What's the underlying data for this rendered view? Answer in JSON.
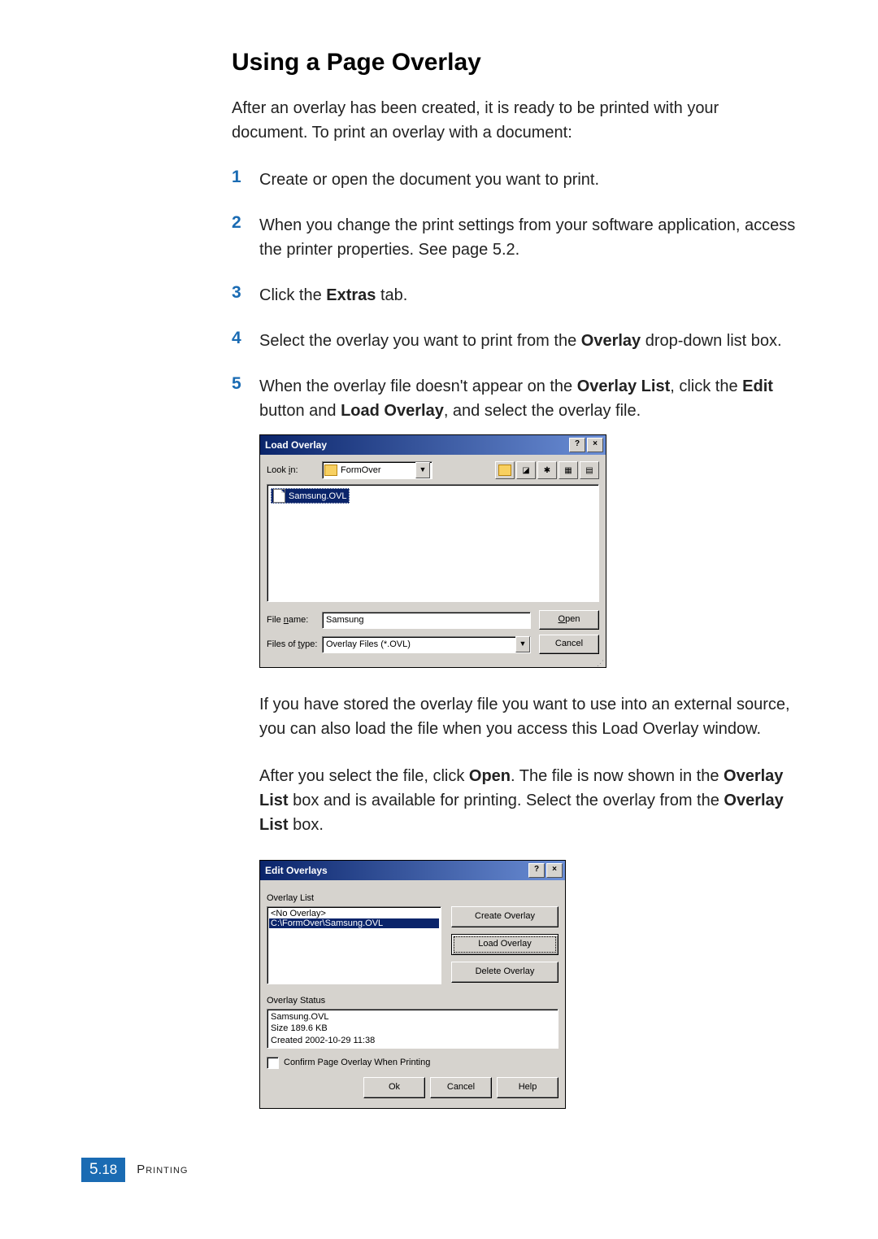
{
  "title": "Using a Page Overlay",
  "intro": "After an overlay has been created, it is ready to be printed with your document. To print an overlay with a document:",
  "steps": {
    "s1": {
      "num": "1",
      "text": "Create or open the document you want to print."
    },
    "s2": {
      "num": "2",
      "text": "When you change the print settings from your software application, access the printer properties. See page 5.2."
    },
    "s3": {
      "num": "3",
      "pre": "Click the ",
      "b1": "Extras",
      "post": " tab."
    },
    "s4": {
      "num": "4",
      "pre": "Select the overlay you want to print from the ",
      "b1": "Overlay",
      "post": " drop-down list box."
    },
    "s5": {
      "num": "5",
      "l1a": "When the overlay file doesn't appear on the ",
      "l1b": "Overlay List",
      "l1c": ", click the ",
      "l1d": "Edit",
      "l1e": " button and ",
      "l1f": "Load Overlay",
      "l1g": ", and select the overlay file.",
      "p2": "If you have stored the overlay file you want to use into an external source, you can also load the file when you access this Load Overlay window.",
      "p3a": "After you select the file, click ",
      "p3b": "Open",
      "p3c": ". The file is now shown in the ",
      "p3d": "Overlay List",
      "p3e": " box and is available for printing. Select the overlay from the ",
      "p3f": "Overlay List",
      "p3g": " box."
    }
  },
  "loadDialog": {
    "title": "Load Overlay",
    "lookin_label": "Look in:",
    "lookin_value": "FormOver",
    "file_item": "Samsung.OVL",
    "filename_label": "File name:",
    "filename_value": "Samsung",
    "filetype_label": "Files of type:",
    "filetype_value": "Overlay Files (*.OVL)",
    "open_btn": "Open",
    "cancel_btn": "Cancel"
  },
  "editDialog": {
    "title": "Edit Overlays",
    "list_label": "Overlay List",
    "items": {
      "i0": "<No Overlay>",
      "i1": "C:\\FormOver\\Samsung.OVL"
    },
    "btn_create": "Create Overlay",
    "btn_load": "Load Overlay",
    "btn_delete": "Delete Overlay",
    "status_label": "Overlay Status",
    "status_line1": "Samsung.OVL",
    "status_line2": "Size 189.6 KB",
    "status_line3": "Created 2002-10-29 11:38",
    "confirm": "Confirm Page Overlay When Printing",
    "ok": "Ok",
    "cancel": "Cancel",
    "help": "Help"
  },
  "footer": {
    "chapter": "5",
    "page": "18",
    "section": "Printing"
  }
}
